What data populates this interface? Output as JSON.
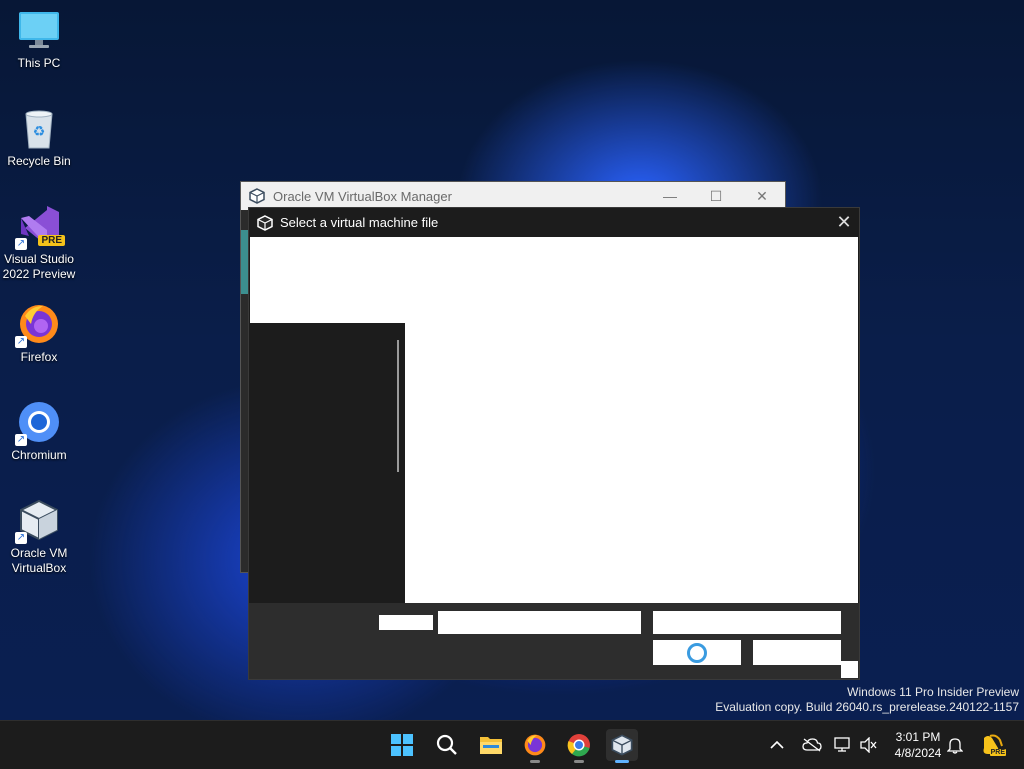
{
  "desktop": {
    "icons": [
      {
        "label": "This PC",
        "icon": "monitor-icon"
      },
      {
        "label": "Recycle Bin",
        "icon": "recycle-bin-icon"
      },
      {
        "label": "Visual Studio\n2022 Preview",
        "icon": "visual-studio-icon",
        "badge": "PRE"
      },
      {
        "label": "Firefox",
        "icon": "firefox-icon"
      },
      {
        "label": "Chromium",
        "icon": "chromium-icon"
      },
      {
        "label": "Oracle VM\nVirtualBox",
        "icon": "virtualbox-icon"
      }
    ]
  },
  "vbox_window": {
    "title": "Oracle VM VirtualBox Manager",
    "minimize": "—",
    "maximize": "☐",
    "close": "✕"
  },
  "dialog": {
    "title": "Select a virtual machine file",
    "close": "✕"
  },
  "watermark": {
    "line1": "Windows 11 Pro Insider Preview",
    "line2": "Evaluation copy. Build 26040.rs_prerelease.240122-1157"
  },
  "taskbar": {
    "apps": [
      "start-icon",
      "search-icon",
      "file-explorer-icon",
      "firefox-icon",
      "chrome-icon",
      "virtualbox-icon"
    ],
    "clock_time": "3:01 PM",
    "clock_date": "4/8/2024",
    "tray_badge": "PRE"
  },
  "colors": {
    "accent": "#5fb2ff",
    "taskbar_bg": "#1c1c1c",
    "dialog_bg": "#1c1c1c"
  }
}
